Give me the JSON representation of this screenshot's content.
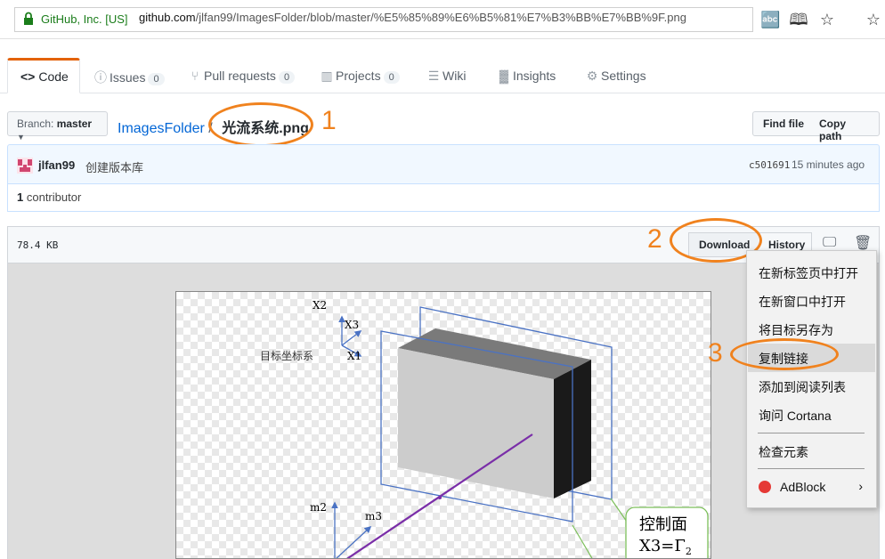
{
  "browser": {
    "secure_label": "GitHub, Inc. [US]",
    "url_host": "github.com",
    "url_path": "/jlfan99/ImagesFolder/blob/master/%E5%85%89%E6%B5%81%E7%B3%BB%E7%BB%9F.png"
  },
  "tabs": [
    {
      "label": "Code"
    },
    {
      "label": "Issues",
      "count": "0"
    },
    {
      "label": "Pull requests",
      "count": "0"
    },
    {
      "label": "Projects",
      "count": "0"
    },
    {
      "label": "Wiki"
    },
    {
      "label": "Insights"
    },
    {
      "label": "Settings"
    }
  ],
  "branch": {
    "prefix": "Branch:",
    "name": "master"
  },
  "breadcrumb": {
    "repo": "ImagesFolder",
    "sep": "/",
    "file": "光流系统.png"
  },
  "actions": {
    "find_file": "Find file",
    "copy_path": "Copy path"
  },
  "commit": {
    "author": "jlfan99",
    "message": "创建版本库",
    "sha": "c501691",
    "time": "15 minutes ago"
  },
  "contributors": {
    "count": "1",
    "label": "contributor"
  },
  "file": {
    "size": "78.4 KB",
    "download": "Download",
    "history": "History"
  },
  "context_menu": {
    "items": [
      "在新标签页中打开",
      "在新窗口中打开",
      "将目标另存为",
      "复制链接",
      "添加到阅读列表",
      "询问 Cortana",
      "检查元素",
      "AdBlock"
    ]
  },
  "annotations": [
    "1",
    "2",
    "3"
  ],
  "image": {
    "axes1": {
      "x2": "X2",
      "x3": "X3",
      "x1": "X1",
      "caption": "目标坐标系"
    },
    "axes2": {
      "m2": "m2",
      "m3": "m3"
    },
    "callout_line1": "控制面",
    "callout_line2": "X3=Γ",
    "callout_sub": "2"
  },
  "colors": {
    "accent_orange": "#f0821e",
    "tab_orange": "#e36209",
    "link": "#0366d6",
    "plane": "#4a72c4",
    "ray": "#7a2ea8"
  }
}
